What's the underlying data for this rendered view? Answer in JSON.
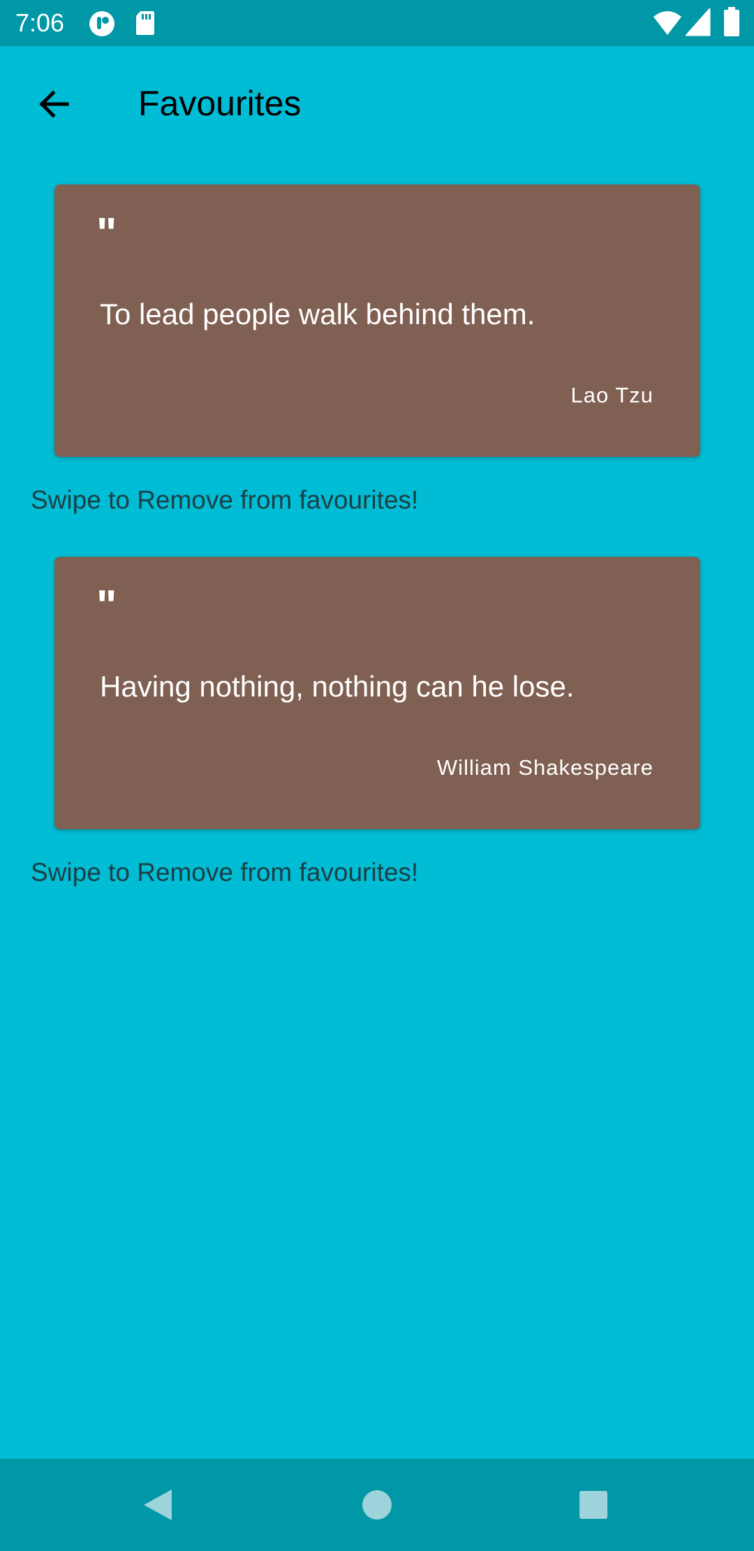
{
  "status_bar": {
    "time": "7:06",
    "icons": [
      "notification-app-icon",
      "sd-card-icon",
      "wifi-icon",
      "signal-icon",
      "battery-icon"
    ]
  },
  "app_bar": {
    "title": "Favourites",
    "back_icon": "arrow-back-icon"
  },
  "favourites": [
    {
      "quote_mark": "\"",
      "text": "To lead people walk behind them.",
      "author": "Lao Tzu",
      "hint": "Swipe to Remove from favourites!"
    },
    {
      "quote_mark": "\"",
      "text": "Having nothing, nothing can he lose.",
      "author": "William Shakespeare",
      "hint": "Swipe to Remove from favourites!"
    }
  ],
  "nav_bar": {
    "buttons": [
      "back-triangle-icon",
      "home-circle-icon",
      "recents-square-icon"
    ]
  },
  "colors": {
    "background": "#00BCD4",
    "status_bar": "#0097A7",
    "card": "#7F6052"
  }
}
